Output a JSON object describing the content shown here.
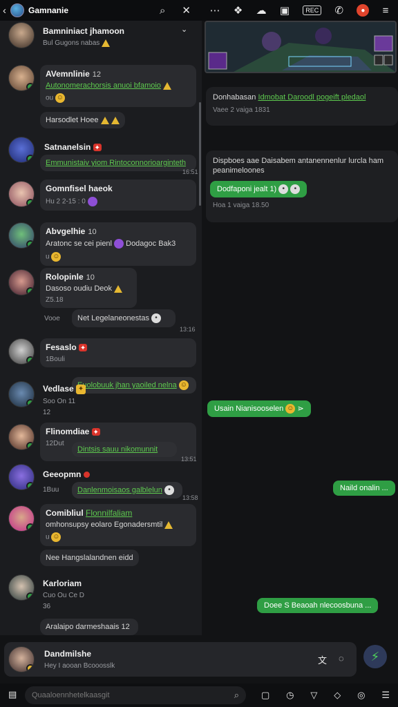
{
  "topbar": {
    "title": "Gamnanie"
  },
  "left_messages": [
    {
      "name": "Bamniniact jhamoon",
      "meta": "Bul  Gugons nabas"
    },
    {
      "name": "AVemnlinie",
      "tag": "12",
      "line": "Autonomerachorsis  anuoi bfamoio",
      "meta": "ou"
    },
    {
      "line": "Harsodlet  Hoee"
    },
    {
      "name": "Satnanelsin",
      "line": "Emmunistaiv  yiom  Rintoconnorioarginteth",
      "time": "16:51"
    },
    {
      "name": "Gomnfisel haeok",
      "meta": "Hu  2 2-15 : 0"
    },
    {
      "name": "Abvgelhie",
      "tag": "10",
      "line": "Aratonc se cei pienl",
      "line2": "Dodagoc Bak3",
      "meta": "u"
    },
    {
      "name": "Rolopinle",
      "tag": "10",
      "line": "Dasoso oudiu Deok",
      "meta": "Z5.18"
    },
    {
      "side": "Vooe",
      "line": "Net Legelaneonestas",
      "time": "13:16"
    },
    {
      "name": "Fesaslo",
      "line": "Euolobuuk jhan  yaoiled nelna",
      "meta": "1Bouli"
    },
    {
      "name": "Vedlase",
      "meta": "Soo  On  11",
      "meta2": "12"
    },
    {
      "name": "Flinomdiae",
      "line": "Dintsis sauu  nikomunnit",
      "meta": "12Dut",
      "time": "13:51"
    },
    {
      "name": "Geeopmn",
      "line": "Danlenmoisaos  galblelun",
      "meta": "1Buu",
      "time": "13:58"
    },
    {
      "name": "Comibliul",
      "tag": "Flonnilfaliam",
      "line": "omhonsupsy eolaro  Egonadersmtil",
      "meta": "u"
    },
    {
      "line": "Nee  Hangslalandnen eidd"
    },
    {
      "name": "Karloriam",
      "meta": "Cuo  Ou  Ce  D",
      "meta2": "36"
    },
    {
      "line": "Aralaipo  darmeshaais",
      "tag": "12"
    }
  ],
  "right": {
    "card1": {
      "title": "Donhabasan",
      "link": "Idmobat  Daroodl  pogeift  pledaol",
      "meta": "Vaee  2  vaiga  1831"
    },
    "card2": {
      "title": "Dispboes aae  Daisabem  antanennenlur  lurcla ham  peanimeloones",
      "pill": "Dodfaponi jealt 1)",
      "meta": "Hoa  1  vaiga  18.50"
    },
    "pill1": "Usain Nianisooselen",
    "pill2": "Naild onalin ...",
    "pill3": "Doee S Beaoah  nlecoosbuna ..."
  },
  "composer": {
    "name": "Dandmilshe",
    "text": "Hey I aooan  Bcooosslk"
  },
  "bottombar": {
    "search_placeholder": "Quaaloennhetelkaasgit"
  }
}
